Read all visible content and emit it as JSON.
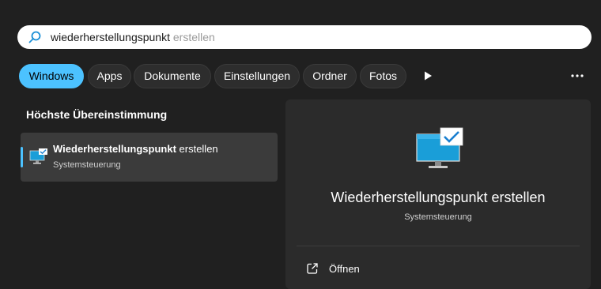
{
  "search": {
    "typed": "wiederherstellungspunkt",
    "suggestion": " erstellen"
  },
  "filters": [
    {
      "label": "Windows",
      "active": true
    },
    {
      "label": "Apps",
      "active": false
    },
    {
      "label": "Dokumente",
      "active": false
    },
    {
      "label": "Einstellungen",
      "active": false
    },
    {
      "label": "Ordner",
      "active": false
    },
    {
      "label": "Fotos",
      "active": false
    }
  ],
  "section": {
    "heading": "Höchste Übereinstimmung"
  },
  "best_match": {
    "title_bold": "Wiederherstellungspunkt",
    "title_rest": " erstellen",
    "subtitle": "Systemsteuerung",
    "icon": "monitor-check-icon"
  },
  "detail": {
    "title": "Wiederherstellungspunkt erstellen",
    "subtitle": "Systemsteuerung",
    "actions": [
      {
        "label": "Öffnen",
        "icon": "open-external-icon"
      }
    ]
  },
  "colors": {
    "accent": "#4cc2ff",
    "background": "#202020",
    "panel": "#2b2b2b",
    "selected_row": "#3b3b3b"
  }
}
